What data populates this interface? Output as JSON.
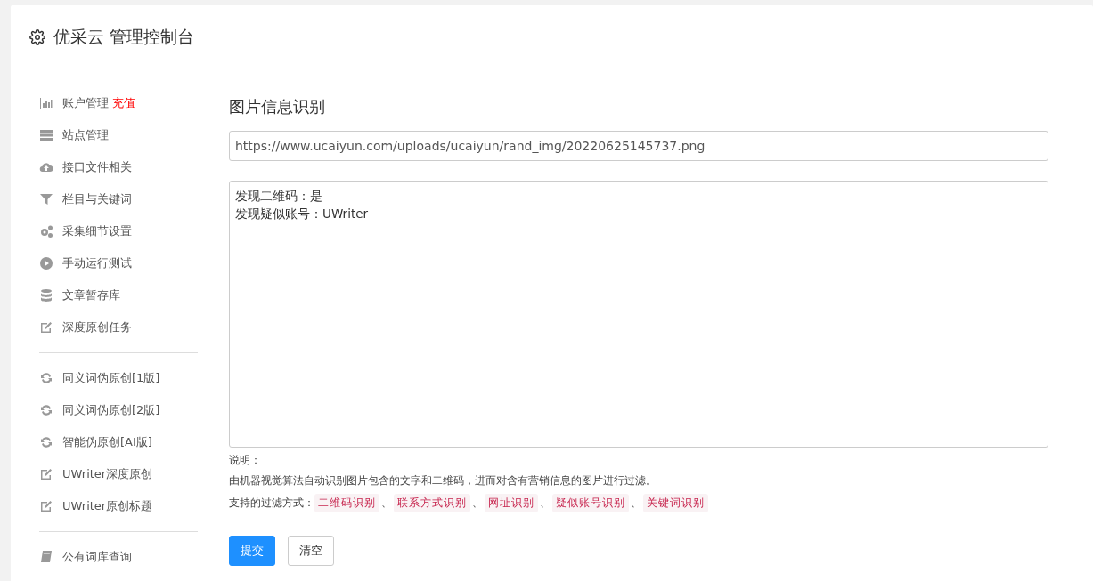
{
  "header": {
    "title": "优采云 管理控制台"
  },
  "sidebar": {
    "groups": [
      [
        {
          "label": "账户管理",
          "badge": "充值"
        },
        {
          "label": "站点管理"
        },
        {
          "label": "接口文件相关"
        },
        {
          "label": "栏目与关键词"
        },
        {
          "label": "采集细节设置"
        },
        {
          "label": "手动运行测试"
        },
        {
          "label": "文章暂存库"
        },
        {
          "label": "深度原创任务"
        }
      ],
      [
        {
          "label": "同义词伪原创[1版]"
        },
        {
          "label": "同义词伪原创[2版]"
        },
        {
          "label": "智能伪原创[AI版]"
        },
        {
          "label": "UWriter深度原创"
        },
        {
          "label": "UWriter原创标题"
        }
      ],
      [
        {
          "label": "公有词库查询"
        }
      ]
    ]
  },
  "form": {
    "title": "图片信息识别",
    "url": "https://www.ucaiyun.com/uploads/ucaiyun/rand_img/20220625145737.png",
    "result": [
      "发现二维码：是",
      "发现疑似账号：UWriter"
    ],
    "note_label": "说明：",
    "note": "由机器视觉算法自动识别图片包含的文字和二维码，进而对含有营销信息的图片进行过滤。",
    "filters_label": "支持的过滤方式：",
    "filters": [
      {
        "kind": "tag",
        "text": "二维码识别"
      },
      {
        "kind": "sep",
        "text": "、"
      },
      {
        "kind": "tag",
        "text": "联系方式识别"
      },
      {
        "kind": "sep",
        "text": "、"
      },
      {
        "kind": "tag",
        "text": "网址识别"
      },
      {
        "kind": "sep",
        "text": "、"
      },
      {
        "kind": "tag",
        "text": "疑似账号识别"
      },
      {
        "kind": "sep",
        "text": "、"
      },
      {
        "kind": "tag",
        "text": "关键词识别"
      }
    ],
    "buttons": [
      {
        "kind": "primary",
        "label": "提交"
      },
      {
        "kind": "default",
        "label": "清空"
      }
    ]
  }
}
